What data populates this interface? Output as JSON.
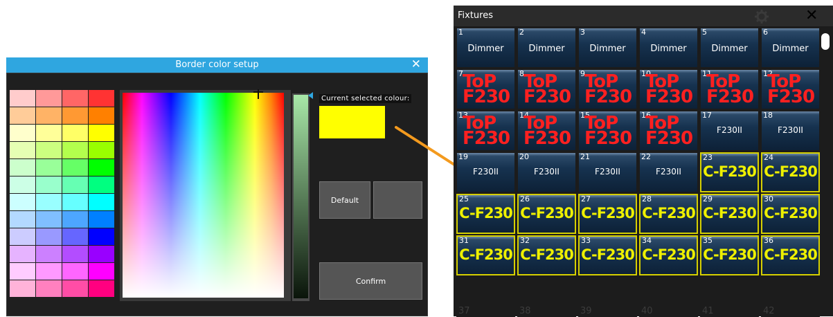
{
  "dialog": {
    "title": "Border color setup",
    "close": "✕",
    "current_label": "Current selected colour:",
    "current_color": "#ffff00",
    "default_button": "Default",
    "blank_button": "",
    "confirm_button": "Confirm",
    "swatch_colors": [
      "#ffcccc",
      "#ff9999",
      "#ff6666",
      "#ff3333",
      "#ffcc99",
      "#ffb366",
      "#ff9933",
      "#ff8000",
      "#ffffcc",
      "#ffff99",
      "#ffff66",
      "#ffff00",
      "#e6ffb3",
      "#ccff80",
      "#b3ff4d",
      "#99ff00",
      "#ccffcc",
      "#99ff99",
      "#66ff66",
      "#00ff00",
      "#ccffe6",
      "#99ffcc",
      "#66ffb3",
      "#00ff80",
      "#ccffff",
      "#99ffff",
      "#66ffff",
      "#00ffff",
      "#b3d9ff",
      "#80bfff",
      "#4da6ff",
      "#0080ff",
      "#ccccff",
      "#9999ff",
      "#6666ff",
      "#0000ff",
      "#e6b3ff",
      "#cc80ff",
      "#b34dff",
      "#9900ff",
      "#ffccff",
      "#ff99ff",
      "#ff66ff",
      "#ff00ff",
      "#ffb3d9",
      "#ff80bf",
      "#ff4da6",
      "#ff0080"
    ]
  },
  "fixtures": {
    "title": "Fixtures",
    "close": "✕",
    "cells": [
      {
        "num": "1",
        "name": "Dimmer",
        "style": "plain"
      },
      {
        "num": "2",
        "name": "Dimmer",
        "style": "plain"
      },
      {
        "num": "3",
        "name": "Dimmer",
        "style": "plain"
      },
      {
        "num": "4",
        "name": "Dimmer",
        "style": "plain"
      },
      {
        "num": "5",
        "name": "Dimmer",
        "style": "plain"
      },
      {
        "num": "6",
        "name": "Dimmer",
        "style": "plain"
      },
      {
        "num": "7",
        "name": "ToP F230",
        "style": "red"
      },
      {
        "num": "8",
        "name": "ToP F230",
        "style": "red"
      },
      {
        "num": "9",
        "name": "ToP F230",
        "style": "red"
      },
      {
        "num": "10",
        "name": "ToP F230",
        "style": "red"
      },
      {
        "num": "11",
        "name": "ToP F230",
        "style": "red"
      },
      {
        "num": "12",
        "name": "ToP F230",
        "style": "red"
      },
      {
        "num": "13",
        "name": "ToP F230",
        "style": "red"
      },
      {
        "num": "14",
        "name": "ToP F230",
        "style": "red"
      },
      {
        "num": "15",
        "name": "ToP F230",
        "style": "red"
      },
      {
        "num": "16",
        "name": "ToP F230",
        "style": "red"
      },
      {
        "num": "17",
        "name": "F230II",
        "style": "small"
      },
      {
        "num": "18",
        "name": "F230II",
        "style": "small"
      },
      {
        "num": "19",
        "name": "F230II",
        "style": "small"
      },
      {
        "num": "20",
        "name": "F230II",
        "style": "small"
      },
      {
        "num": "21",
        "name": "F230II",
        "style": "small"
      },
      {
        "num": "22",
        "name": "F230II",
        "style": "small"
      },
      {
        "num": "23",
        "name": "C-F230",
        "style": "yellow"
      },
      {
        "num": "24",
        "name": "C-F230",
        "style": "yellow"
      },
      {
        "num": "25",
        "name": "C-F230",
        "style": "yellow"
      },
      {
        "num": "26",
        "name": "C-F230",
        "style": "yellow"
      },
      {
        "num": "27",
        "name": "C-F230",
        "style": "yellow"
      },
      {
        "num": "28",
        "name": "C-F230",
        "style": "yellow"
      },
      {
        "num": "29",
        "name": "C-F230",
        "style": "yellow"
      },
      {
        "num": "30",
        "name": "C-F230",
        "style": "yellow"
      },
      {
        "num": "31",
        "name": "C-F230",
        "style": "yellow"
      },
      {
        "num": "32",
        "name": "C-F230",
        "style": "yellow"
      },
      {
        "num": "33",
        "name": "C-F230",
        "style": "yellow"
      },
      {
        "num": "34",
        "name": "C-F230",
        "style": "yellow"
      },
      {
        "num": "35",
        "name": "C-F230",
        "style": "yellow"
      },
      {
        "num": "36",
        "name": "C-F230",
        "style": "yellow"
      },
      {
        "num": "37",
        "name": "",
        "style": "empty"
      },
      {
        "num": "38",
        "name": "",
        "style": "empty"
      },
      {
        "num": "39",
        "name": "",
        "style": "empty"
      },
      {
        "num": "40",
        "name": "",
        "style": "empty"
      },
      {
        "num": "41",
        "name": "",
        "style": "empty"
      },
      {
        "num": "42",
        "name": "",
        "style": "empty"
      }
    ]
  },
  "colors": {
    "title_bar": "#2fa6e0",
    "arrow": "#f39a1e",
    "selected_border": "#d6d000"
  }
}
